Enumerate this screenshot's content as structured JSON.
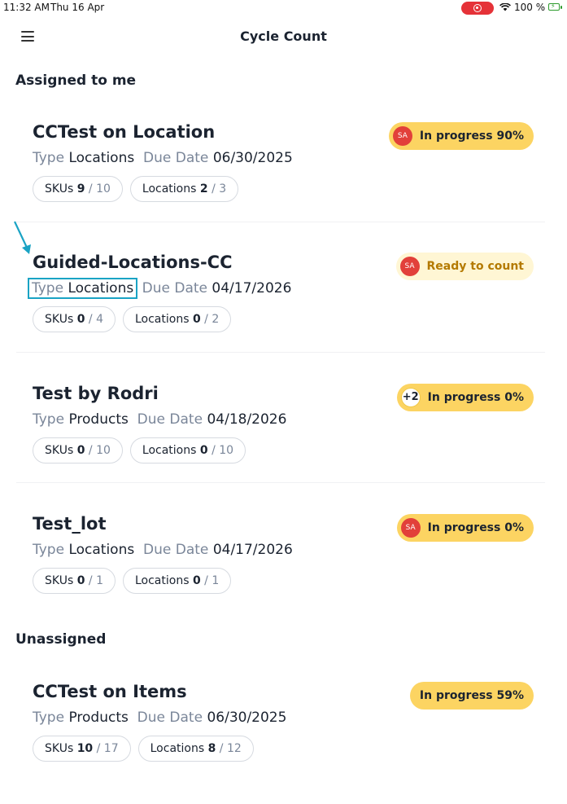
{
  "status_bar": {
    "time": "11:32 AM",
    "date": "Thu 16 Apr",
    "battery": "100 %"
  },
  "header": {
    "title": "Cycle Count",
    "menu_icon": "hamburger-menu-icon"
  },
  "sections": {
    "assigned_title": "Assigned to me",
    "unassigned_title": "Unassigned"
  },
  "labels": {
    "type": "Type",
    "due_date": "Due Date",
    "skus": "SKUs",
    "locations": "Locations",
    "separator": "/"
  },
  "cards": [
    {
      "title": "CCTest on Location",
      "type": "Locations",
      "due_date": "06/30/2025",
      "skus_done": "9",
      "skus_total": "10",
      "locations_done": "2",
      "locations_total": "3",
      "badge_avatar": "SA",
      "badge_text": "In progress 90%"
    },
    {
      "title": "Guided-Locations-CC",
      "type": "Locations",
      "due_date": "04/17/2026",
      "skus_done": "0",
      "skus_total": "4",
      "locations_done": "0",
      "locations_total": "2",
      "badge_avatar": "SA",
      "badge_text": "Ready to count"
    },
    {
      "title": "Test by Rodri",
      "type": "Products",
      "due_date": "04/18/2026",
      "skus_done": "0",
      "skus_total": "10",
      "locations_done": "0",
      "locations_total": "10",
      "badge_avatar": "+2",
      "badge_text": "In progress 0%"
    },
    {
      "title": "Test_lot",
      "type": "Locations",
      "due_date": "04/17/2026",
      "skus_done": "0",
      "skus_total": "1",
      "locations_done": "0",
      "locations_total": "1",
      "badge_avatar": "SA",
      "badge_text": "In progress 0%"
    },
    {
      "title": "CCTest on Items",
      "type": "Products",
      "due_date": "06/30/2025",
      "skus_done": "10",
      "skus_total": "17",
      "locations_done": "8",
      "locations_total": "12",
      "badge_text": "In progress 59%"
    }
  ],
  "colors": {
    "badge_in_progress": "#fcd462",
    "badge_ready": "#fff6d4",
    "avatar": "#e2403a",
    "annotation": "#1aa3c4"
  }
}
